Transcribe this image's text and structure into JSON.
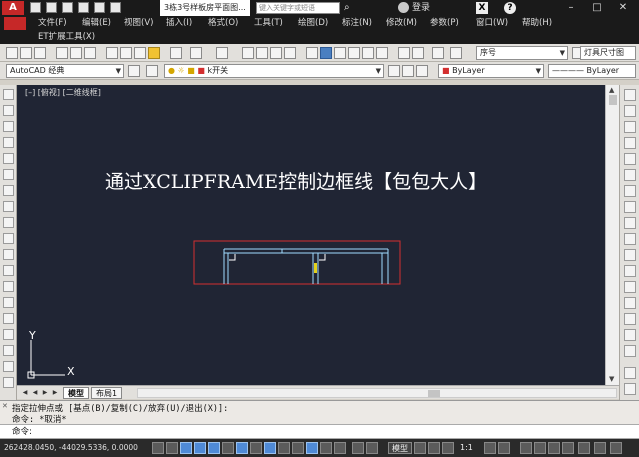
{
  "titlebar": {
    "app_logo": "A",
    "doc_tab": "3栋3号样板房平面图...",
    "search_placeholder": "键入关键字或短语",
    "login": "登录",
    "x_label": "X",
    "help_label": "?",
    "min": "–",
    "max": "□",
    "close": "✕"
  },
  "menu": {
    "items": [
      "文件(F)",
      "编辑(E)",
      "视图(V)",
      "插入(I)",
      "格式(O)",
      "工具(T)",
      "绘图(D)",
      "标注(N)",
      "修改(M)",
      "参数(P)",
      "窗口(W)",
      "帮助(H)"
    ]
  },
  "et_menu": {
    "label": "ET扩展工具(X)"
  },
  "toolbar1": {
    "style_combo": "序号",
    "dim_combo": "灯具尺寸图"
  },
  "toolbar2": {
    "workspace": "AutoCAD 经典",
    "layer_combo": "k开关",
    "color_combo": "ByLayer",
    "linetype_combo": "ByLayer"
  },
  "canvas": {
    "view_label": "[–] [俯视] [二维线框]",
    "overlay_title": "通过XCLIPFRAME控制边框线【包包大人】",
    "ucs_x": "X",
    "ucs_y": "Y"
  },
  "tabs": {
    "items": [
      "模型",
      "布局1"
    ],
    "active": "模型"
  },
  "command": {
    "history": [
      "指定拉伸点或 [基点(B)/复制(C)/放弃(U)/退出(X)]:",
      "命令: *取消*"
    ],
    "prompt": "命令:"
  },
  "status": {
    "coords": "262428.0450, -44029.5336, 0.0000",
    "model_label": "模型",
    "scale": "1:1"
  },
  "colors": {
    "canvas_bg": "#202534",
    "selection_red": "#d32f2f",
    "drawing_cyan": "#9fdcff",
    "accent_brand": "#c62828"
  }
}
